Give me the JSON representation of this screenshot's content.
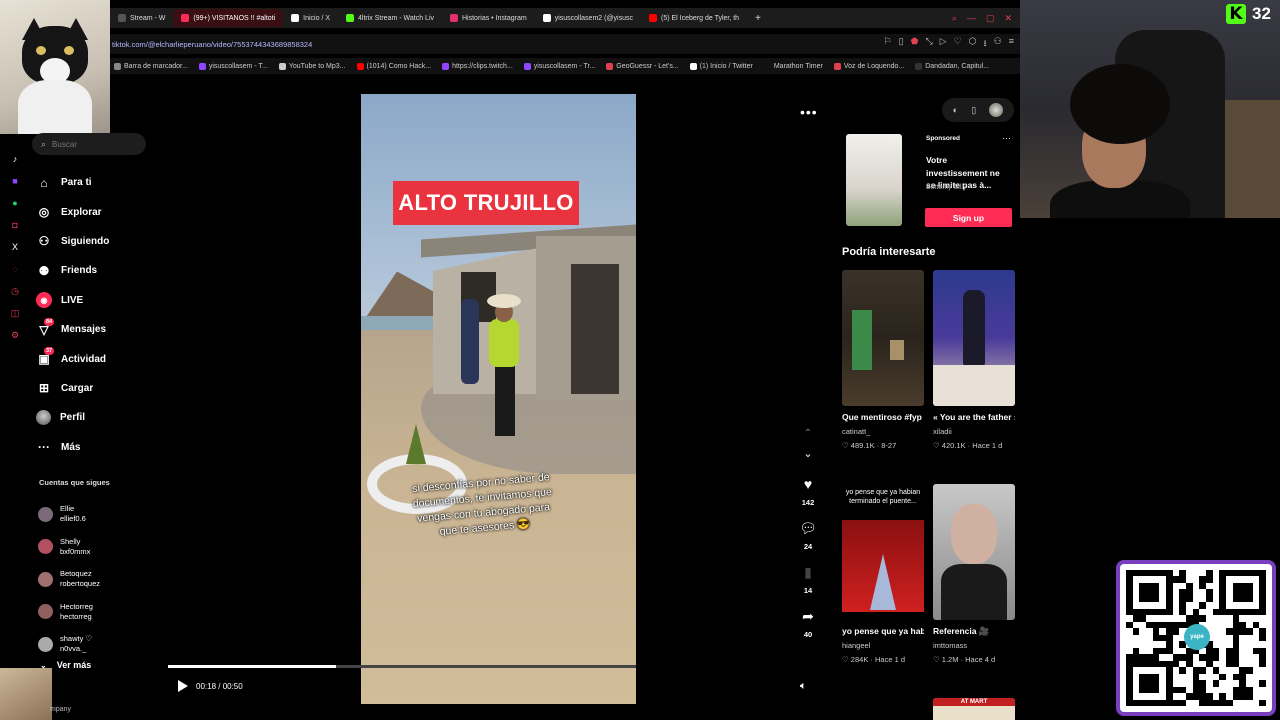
{
  "browser": {
    "tabs": [
      {
        "label": "Stream - W",
        "color": "#555555",
        "active": false
      },
      {
        "label": "(99+) VISITANOS !! #altoti",
        "color": "#fe2c55",
        "active": true
      },
      {
        "label": "Inicio / X",
        "color": "#ffffff",
        "active": false
      },
      {
        "label": "4ltrix Stream - Watch Liv",
        "color": "#53fc18",
        "active": false
      },
      {
        "label": "Historias • Instagram",
        "color": "#e1306c",
        "active": false
      },
      {
        "label": "yisuscollasem2 (@yisusc",
        "color": "#ffffff",
        "active": false
      },
      {
        "label": "(5) El Iceberg de Tyler, th",
        "color": "#ff0000",
        "active": false
      }
    ],
    "new_tab": "+",
    "url": "tiktok.com/@elcharlieperuano/video/7553744343689858324",
    "bookmarks": [
      {
        "label": "Barra de marcador...",
        "color": "#888888"
      },
      {
        "label": "yisuscollasem - T...",
        "color": "#9146ff"
      },
      {
        "label": "YouTube to Mp3...",
        "color": "#cccccc"
      },
      {
        "label": "(1014) Como Hack...",
        "color": "#ff0000"
      },
      {
        "label": "https://clips.twitch...",
        "color": "#9146ff"
      },
      {
        "label": "yisuscollasem - Tr...",
        "color": "#9146ff"
      },
      {
        "label": "GeoGuessr - Let's...",
        "color": "#e04050"
      },
      {
        "label": "(1) Inicio / Twitter",
        "color": "#ffffff"
      },
      {
        "label": "Marathon Timer",
        "color": "#111111"
      },
      {
        "label": "Voz de Loquendo...",
        "color": "#e04050"
      },
      {
        "label": "Dandadan, Capitul...",
        "color": "#333333"
      }
    ]
  },
  "stream": {
    "kick_count": "32",
    "kick_color": "#53fc18"
  },
  "sidebar": {
    "search_placeholder": "Buscar",
    "nav": [
      {
        "label": "Para ti",
        "icon": "home-icon",
        "glyph": "⌂"
      },
      {
        "label": "Explorar",
        "icon": "compass-icon",
        "glyph": "◎"
      },
      {
        "label": "Siguiendo",
        "icon": "following-icon",
        "glyph": "⚇"
      },
      {
        "label": "Friends",
        "icon": "friends-icon",
        "glyph": "⚉"
      },
      {
        "label": "LIVE",
        "icon": "live-icon",
        "glyph": "●"
      },
      {
        "label": "Mensajes",
        "icon": "messages-icon",
        "glyph": "▽",
        "badge": "84"
      },
      {
        "label": "Actividad",
        "icon": "activity-icon",
        "glyph": "▣",
        "badge": "37"
      },
      {
        "label": "Cargar",
        "icon": "upload-icon",
        "glyph": "⊞"
      },
      {
        "label": "Perfil",
        "icon": "profile-avatar",
        "glyph": ""
      },
      {
        "label": "Más",
        "icon": "more-icon",
        "glyph": "···"
      }
    ],
    "following_title": "Cuentas que sigues",
    "following": [
      {
        "name": "Ellie",
        "user": "ellief0.6",
        "color": "#7a6a7a"
      },
      {
        "name": "Shelly",
        "user": "bxf0mmx",
        "color": "#b05060"
      },
      {
        "name": "Betoquez",
        "user": "robertoquez",
        "color": "#a07070"
      },
      {
        "name": "Hectorreg",
        "user": "hectorreg",
        "color": "#906060"
      },
      {
        "name": "shawty ♡",
        "user": "n0vva._",
        "color": "#aaaaaa"
      }
    ],
    "see_more": "Ver más",
    "company": "mpany"
  },
  "video": {
    "banner": "ALTO TRUJILLO",
    "caption": "si desconfías por no saber de documentos, te invitamos que vengas con tu abogado para que te asesores 😎",
    "time": "00:18 / 00:50",
    "progress": 0.36,
    "likes": "142",
    "comments": "24",
    "saves": "14",
    "shares": "40"
  },
  "ad": {
    "sponsored": "Sponsored",
    "title": "Votre investissement ne se limite pas à...",
    "brand": "Butterfly Silly",
    "cta": "Sign up"
  },
  "recommended": {
    "title": "Podría interesarte",
    "items": [
      {
        "title": "Que mentiroso #fyp #minecraf...",
        "author": "catinatt_",
        "meta": "♡ 489.1K · 8-27",
        "thumb_text": ""
      },
      {
        "title": "« You are the father » cat edition...",
        "author": "xiladii",
        "meta": "♡ 420.1K · Hace 1 d",
        "thumb_text": ""
      },
      {
        "title": "yo pense que ya habian terminado e...",
        "author": "hiangeel",
        "meta": "♡ 284K · Hace 1 d",
        "thumb_text": "yo pense que ya habian terminado el puente..."
      },
      {
        "title": "Referencia 🎥",
        "author": "imttomass",
        "meta": "♡ 1.2M · Hace 4 d",
        "thumb_text": ""
      }
    ],
    "partial_label": "AT MART"
  },
  "qr": {
    "logo": "yape"
  }
}
